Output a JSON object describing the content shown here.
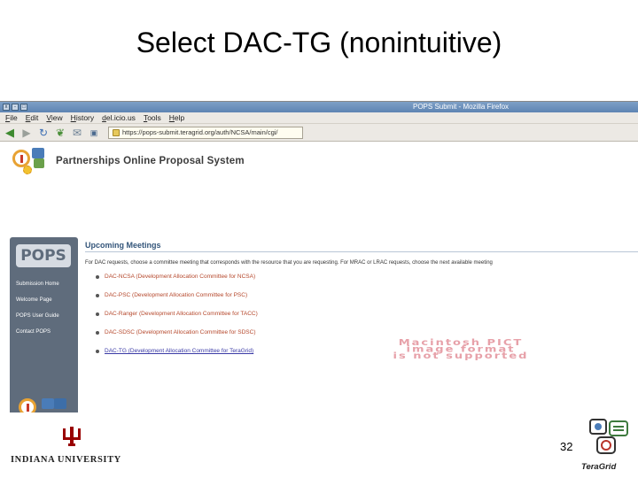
{
  "slide": {
    "title": "Select DAC-TG (nonintuitive)",
    "page_number": "32"
  },
  "browser": {
    "window_title": "POPS Submit - Mozilla Firefox",
    "window_buttons": [
      "x",
      "-",
      "□"
    ],
    "menu": [
      "File",
      "Edit",
      "View",
      "History",
      "del.icio.us",
      "Tools",
      "Help"
    ],
    "url": "https://pops-submit.teragrid.org/auth/NCSA/main/cgi/"
  },
  "page": {
    "header_title": "Partnerships Online Proposal System",
    "sidebar": {
      "logo_text": "POPS",
      "links": [
        "Submission Home",
        "Welcome Page",
        "POPS User Guide",
        "Contact POPS"
      ]
    },
    "meetings": {
      "heading": "Upcoming Meetings",
      "intro": "For DAC requests, choose a committee meeting that corresponds with the resource that you are requesting.  For MRAC or LRAC requests, choose the next available meeting",
      "items": [
        "DAC-NCSA (Development Allocation Committee for NCSA)",
        "DAC-PSC (Development Allocation Committee for PSC)",
        "DAC-Ranger (Development Allocation Committee for TACC)",
        "DAC-SDSC (Development Allocation Committee for SDSC)",
        "DAC-TG (Development Allocation Committee for TeraGrid)"
      ],
      "selected_index": 4
    },
    "placeholder_message": [
      "Macintosh PICT",
      "image format",
      "is not supported"
    ]
  },
  "footer": {
    "university": "INDIANA UNIVERSITY",
    "teragrid": "TeraGrid"
  },
  "colors": {
    "sidebar_bg": "#5f6c7c",
    "link_color": "#b5472b",
    "heading_color": "#33557a",
    "iu_crimson": "#990000"
  }
}
